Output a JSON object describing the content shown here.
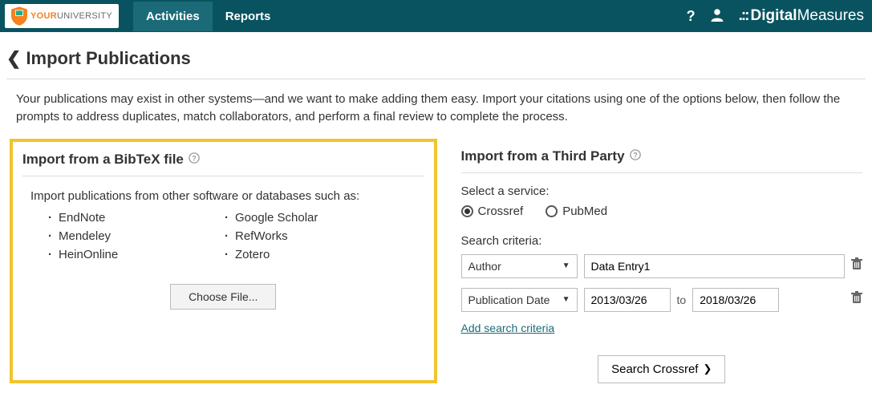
{
  "header": {
    "logo_your": "YOUR",
    "logo_university": "UNIVERSITY",
    "nav": [
      {
        "label": "Activities",
        "active": true
      },
      {
        "label": "Reports",
        "active": false
      }
    ],
    "brand_prefix": ".::",
    "brand_digital": "Digital",
    "brand_measures": "Measures"
  },
  "page": {
    "title": "Import Publications",
    "intro": "Your publications may exist in other systems—and we want to make adding them easy. Import your citations using one of the options below, then follow the prompts to address duplicates, match collaborators, and perform a final review to complete the process."
  },
  "bibtex": {
    "title": "Import from a BibTeX file",
    "desc": "Import publications from other software or databases such as:",
    "col1": [
      "EndNote",
      "Mendeley",
      "HeinOnline"
    ],
    "col2": [
      "Google Scholar",
      "RefWorks",
      "Zotero"
    ],
    "choose_file": "Choose File..."
  },
  "thirdparty": {
    "title": "Import from a Third Party",
    "select_service": "Select a service:",
    "services": [
      {
        "label": "Crossref",
        "selected": true
      },
      {
        "label": "PubMed",
        "selected": false
      }
    ],
    "criteria_label": "Search criteria:",
    "row1": {
      "field": "Author",
      "value": "Data Entry1"
    },
    "row2": {
      "field": "Publication Date",
      "from": "2013/03/26",
      "to_label": "to",
      "to": "2018/03/26"
    },
    "add_criteria": "Add search criteria",
    "search_btn": "Search Crossref"
  }
}
